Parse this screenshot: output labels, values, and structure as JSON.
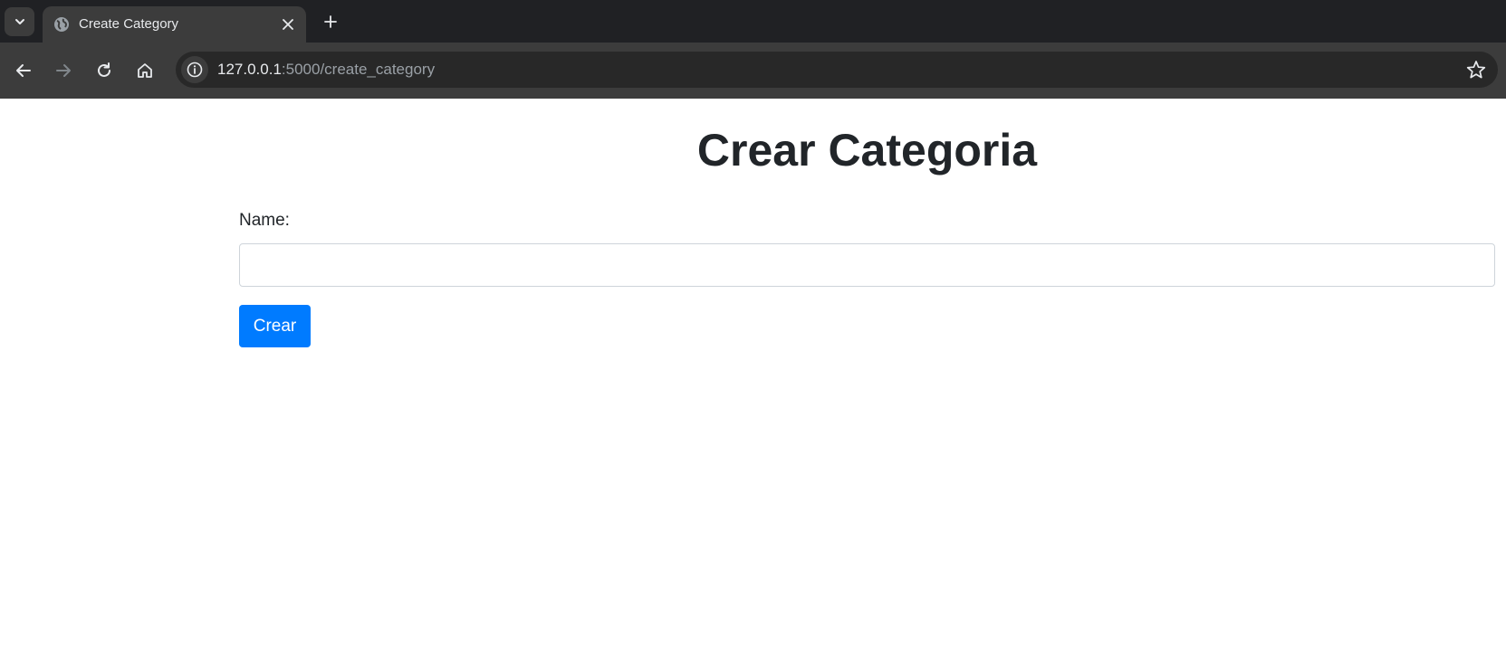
{
  "browser": {
    "tab": {
      "title": "Create Category"
    },
    "address_bar": {
      "host": "127.0.0.1",
      "path": ":5000/create_category"
    },
    "icons": {
      "tab_search": "chevron-down-icon",
      "favicon": "globe-icon",
      "close_tab": "close-icon",
      "new_tab": "plus-icon",
      "back": "arrow-left-icon",
      "forward": "arrow-right-icon",
      "reload": "reload-icon",
      "home": "home-icon",
      "site_info": "info-icon",
      "bookmark": "star-icon"
    }
  },
  "page": {
    "title": "Crear Categoria",
    "form": {
      "name_label": "Name:",
      "name_value": "",
      "submit_label": "Crear"
    }
  },
  "colors": {
    "primary_button": "#007bff",
    "text": "#212529",
    "chrome_dark": "#202124",
    "chrome_toolbar": "#3c3c3c"
  }
}
